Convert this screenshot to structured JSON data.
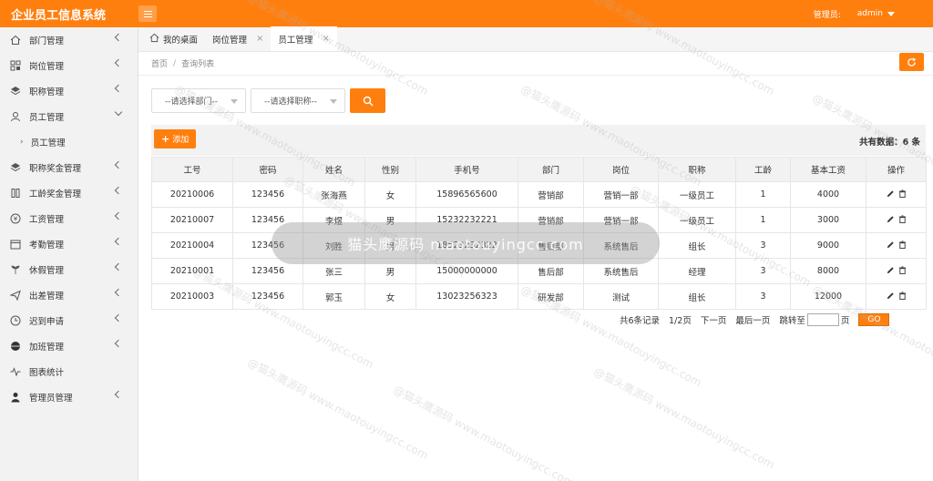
{
  "app": {
    "title": "企业员工信息系统"
  },
  "header": {
    "role_label": "管理员:",
    "username": "admin"
  },
  "sidebar": {
    "items": [
      {
        "label": "部门管理",
        "icon": "home-icon"
      },
      {
        "label": "岗位管理",
        "icon": "grid-icon"
      },
      {
        "label": "职称管理",
        "icon": "layers-icon"
      },
      {
        "label": "员工管理",
        "icon": "user-icon",
        "expanded": true,
        "children": [
          "员工管理"
        ]
      },
      {
        "label": "职称奖金管理",
        "icon": "layers-icon"
      },
      {
        "label": "工龄奖金管理",
        "icon": "book-icon"
      },
      {
        "label": "工资管理",
        "icon": "yen-icon"
      },
      {
        "label": "考勤管理",
        "icon": "calendar-icon"
      },
      {
        "label": "休假管理",
        "icon": "plant-icon"
      },
      {
        "label": "出差管理",
        "icon": "send-icon"
      },
      {
        "label": "迟到申请",
        "icon": "clock-icon"
      },
      {
        "label": "加班管理",
        "icon": "circle-icon"
      },
      {
        "label": "图表统计",
        "icon": "pulse-icon"
      },
      {
        "label": "管理员管理",
        "icon": "person-icon"
      }
    ]
  },
  "tabs": [
    {
      "label": "我的桌面",
      "icon": "home-icon"
    },
    {
      "label": "岗位管理",
      "closable": true
    },
    {
      "label": "员工管理",
      "closable": true,
      "active": true
    }
  ],
  "breadcrumb": {
    "home": "首页",
    "current": "查询列表"
  },
  "filter": {
    "dept_placeholder": "--请选择部门--",
    "title_placeholder": "--请选择职称--"
  },
  "toolbar": {
    "add_label": "添加",
    "count_text": "共有数据：6 条"
  },
  "table": {
    "headers": [
      "工号",
      "密码",
      "姓名",
      "性别",
      "手机号",
      "部门",
      "岗位",
      "职称",
      "工龄",
      "基本工资",
      "操作"
    ],
    "rows": [
      [
        "20210006",
        "123456",
        "张海燕",
        "女",
        "15896565600",
        "营销部",
        "营销一部",
        "一级员工",
        "1",
        "4000"
      ],
      [
        "20210007",
        "123456",
        "李煜",
        "男",
        "15232232221",
        "营销部",
        "营销一部",
        "一级员工",
        "1",
        "3000"
      ],
      [
        "20210004",
        "123456",
        "刘胜",
        "男",
        "18523232322",
        "售后部",
        "系统售后",
        "组长",
        "3",
        "9000"
      ],
      [
        "20210001",
        "123456",
        "张三",
        "男",
        "15000000000",
        "售后部",
        "系统售后",
        "经理",
        "3",
        "8000"
      ],
      [
        "20210003",
        "123456",
        "郭玉",
        "女",
        "13023256323",
        "研发部",
        "测试",
        "组长",
        "3",
        "12000"
      ]
    ]
  },
  "pager": {
    "records": "共6条记录",
    "pages": "1/2页",
    "next": "下一页",
    "last": "最后一页",
    "jump_label": "跳转至",
    "page_suffix": "页",
    "go": "GO"
  },
  "watermark": {
    "banner": "猫头鹰源码 maotouyingcc.com",
    "text": "@猫头鹰源码 www.maotouyingcc.com"
  },
  "colors": {
    "accent": "#ff7f0e"
  }
}
